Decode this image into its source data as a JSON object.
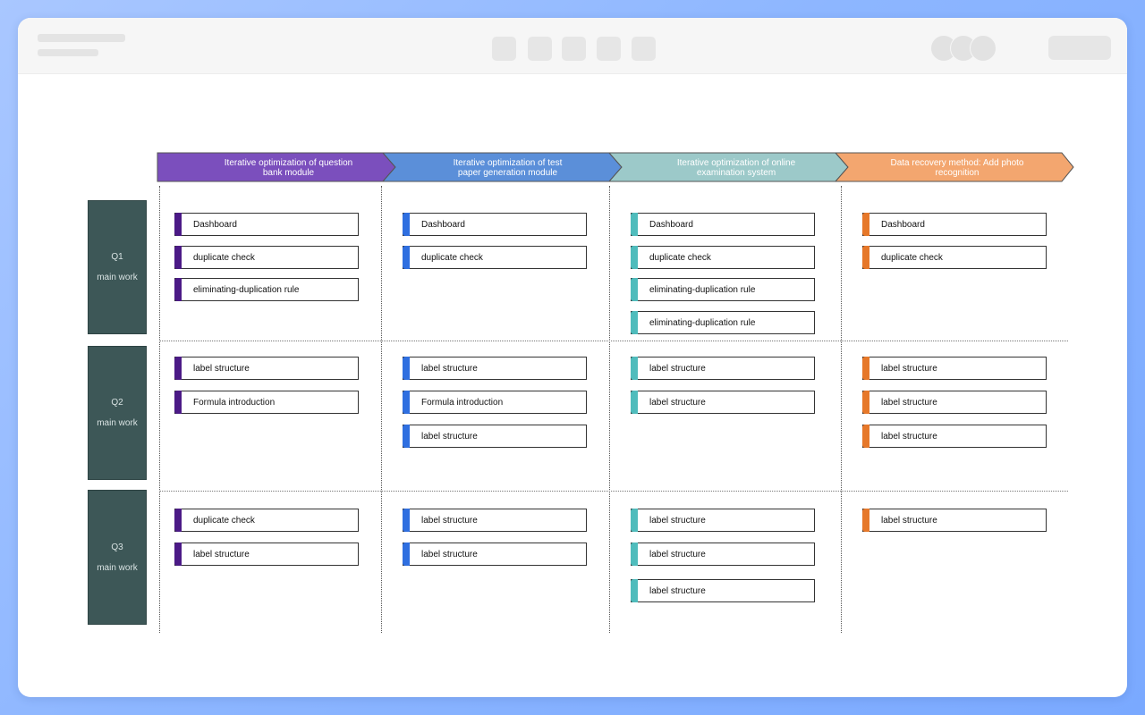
{
  "colors": {
    "stage1": "#7b4fbd",
    "stage2": "#5b8fd9",
    "stage3": "#9cc9c9",
    "stage4": "#f3a66f",
    "tab1": "#4b1a86",
    "tab2": "#2f6fe0",
    "tab3": "#4fbcbc",
    "tab4": "#e6782a",
    "row_label_bg": "#3d5757"
  },
  "stages": [
    {
      "title": "Iterative optimization of question bank module"
    },
    {
      "title": "Iterative optimization of test paper generation module"
    },
    {
      "title": "Iterative optimization of online examination system"
    },
    {
      "title": "Data recovery method: Add photo recognition"
    }
  ],
  "rows": [
    {
      "quarter": "Q1",
      "subtitle": "main work"
    },
    {
      "quarter": "Q2",
      "subtitle": "main work"
    },
    {
      "quarter": "Q3",
      "subtitle": "main work"
    }
  ],
  "cells": {
    "q1": [
      [
        "Dashboard",
        "duplicate check",
        "eliminating-duplication rule"
      ],
      [
        "Dashboard",
        "duplicate check"
      ],
      [
        "Dashboard",
        "duplicate check",
        "eliminating-duplication rule",
        "eliminating-duplication rule"
      ],
      [
        "Dashboard",
        "duplicate check"
      ]
    ],
    "q2": [
      [
        "label structure",
        "Formula introduction"
      ],
      [
        "label structure",
        "Formula introduction",
        "label structure"
      ],
      [
        "label structure",
        "label structure"
      ],
      [
        "label structure",
        "label structure",
        "label structure"
      ]
    ],
    "q3": [
      [
        "duplicate check",
        "label structure"
      ],
      [
        "label structure",
        "label structure"
      ],
      [
        "label structure",
        "label structure",
        "label structure"
      ],
      [
        "label structure"
      ]
    ]
  }
}
